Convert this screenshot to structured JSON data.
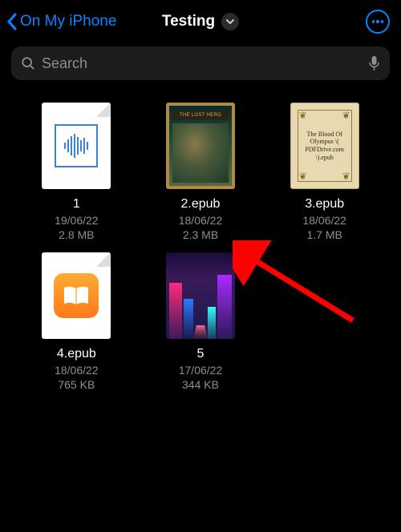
{
  "header": {
    "back_label": "On My iPhone",
    "title": "Testing"
  },
  "search": {
    "placeholder": "Search",
    "value": ""
  },
  "files": [
    {
      "name": "1",
      "date": "19/06/22",
      "size": "2.8 MB",
      "thumb": "audio",
      "cover_text": ""
    },
    {
      "name": "2.epub",
      "date": "18/06/22",
      "size": "2.3 MB",
      "thumb": "cover1",
      "cover_text": "THE LOST HERO"
    },
    {
      "name": "3.epub",
      "date": "18/06/22",
      "size": "1.7 MB",
      "thumb": "cover2",
      "cover_text": "The Blood Of Olympus \\( PDFDrive.com \\).epub"
    },
    {
      "name": "4.epub",
      "date": "18/06/22",
      "size": "765 KB",
      "thumb": "ibooks",
      "cover_text": ""
    },
    {
      "name": "5",
      "date": "17/06/22",
      "size": "344 KB",
      "thumb": "neon",
      "cover_text": ""
    }
  ],
  "annotation": {
    "arrow_color": "#ff0000"
  }
}
